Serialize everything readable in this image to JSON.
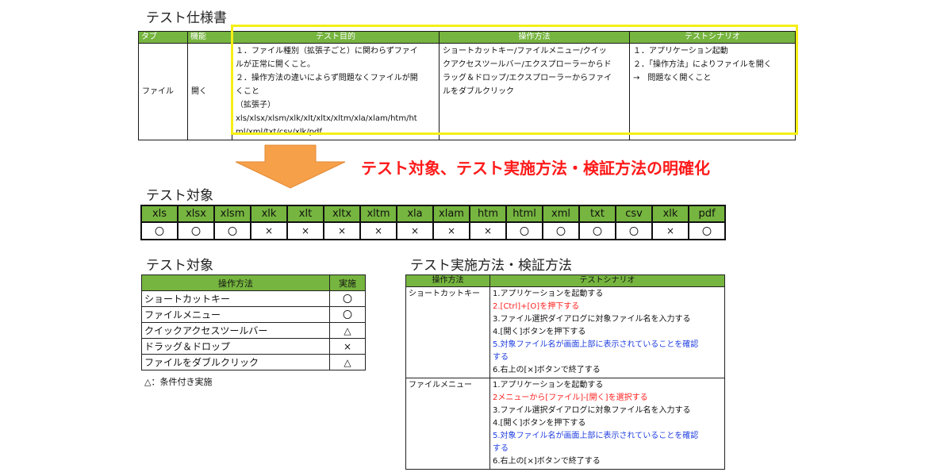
{
  "spec_title": "テスト仕様書",
  "spec_table": {
    "headers": [
      "タブ",
      "機能",
      "テスト目的",
      "操作方法",
      "テストシナリオ"
    ],
    "row": {
      "tab": "ファイル",
      "function": "開く",
      "purpose": [
        "１．ファイル種別（拡張子ごと）に関わらずファイ",
        "ルが正常に開くこと。",
        "２．操作方法の違いによらず問題なくファイルが開",
        "くこと",
        "（拡張子）",
        "xls/xlsx/xlsm/xlk/xlt/xltx/xltm/xla/xlam/htm/ht",
        "ml/xml/txt/csv/xlk/pdf"
      ],
      "method": [
        "ショートカットキー/ファイルメニュー/クイッ",
        "クアクセスツールバー/エクスプローラーからド",
        "ラッグ＆ドロップ/エクスプローラーからファイ",
        "ルをダブルクリック"
      ],
      "scenario": [
        "１．アプリケーション起動",
        "２．「操作方法」によりファイルを開く",
        "→　問題なく開くこと"
      ]
    }
  },
  "banner": "テスト対象、テスト実施方法・検証方法の明確化",
  "target_title": "テスト対象",
  "extensions": {
    "headers": [
      "xls",
      "xlsx",
      "xlsm",
      "xlk",
      "xlt",
      "xltx",
      "xltm",
      "xla",
      "xlam",
      "htm",
      "html",
      "xml",
      "txt",
      "csv",
      "xlk",
      "pdf"
    ],
    "values": [
      "〇",
      "〇",
      "〇",
      "×",
      "×",
      "×",
      "×",
      "×",
      "×",
      "×",
      "〇",
      "〇",
      "〇",
      "〇",
      "×",
      "〇"
    ]
  },
  "op_title": "テスト対象",
  "op_table": {
    "headers": [
      "操作方法",
      "実施"
    ],
    "rows": [
      {
        "method": "ショートカットキー",
        "mark": "〇"
      },
      {
        "method": "ファイルメニュー",
        "mark": "〇"
      },
      {
        "method": "クイックアクセスツールバー",
        "mark": "△"
      },
      {
        "method": "ドラッグ＆ドロップ",
        "mark": "×"
      },
      {
        "method": "ファイルをダブルクリック",
        "mark": "△"
      }
    ]
  },
  "op_note": "△：条件付き実施",
  "method_title": "テスト実施方法・検証方法",
  "scenario_table": {
    "headers": [
      "操作方法",
      "テストシナリオ"
    ],
    "rows": [
      {
        "method": "ショートカットキー",
        "steps": [
          {
            "text": "1.アプリケーションを起動する",
            "color": "black"
          },
          {
            "text": "2.[Ctrl]+[O]を押下する",
            "color": "red"
          },
          {
            "text": "3.ファイル選択ダイアログに対象ファイル名を入力する",
            "color": "black"
          },
          {
            "text": "4.[開く]ボタンを押下する",
            "color": "black"
          },
          {
            "text": "5.対象ファイル名が画面上部に表示されていることを確認",
            "color": "blue"
          },
          {
            "text": "する",
            "color": "blue"
          },
          {
            "text": "6.右上の[×]ボタンで終了する",
            "color": "black"
          }
        ]
      },
      {
        "method": "ファイルメニュー",
        "steps": [
          {
            "text": "1.アプリケーションを起動する",
            "color": "black"
          },
          {
            "text": "2メニューから[ファイル]-[開く]を選択する",
            "color": "red"
          },
          {
            "text": "3.ファイル選択ダイアログに対象ファイル名を入力する",
            "color": "black"
          },
          {
            "text": "4.[開く]ボタンを押下する",
            "color": "black"
          },
          {
            "text": "5.対象ファイル名が画面上部に表示されていることを確認",
            "color": "blue"
          },
          {
            "text": "する",
            "color": "blue"
          },
          {
            "text": "6.右上の[×]ボタンで終了する",
            "color": "black"
          }
        ]
      }
    ]
  },
  "colors": {
    "header_green": "#76b53f",
    "highlight_yellow": "#f5ef15",
    "arrow_orange": "#f7a04a",
    "banner_red": "#ff1a1a",
    "step_red": "#ff2020",
    "step_blue": "#1f3ee0"
  }
}
